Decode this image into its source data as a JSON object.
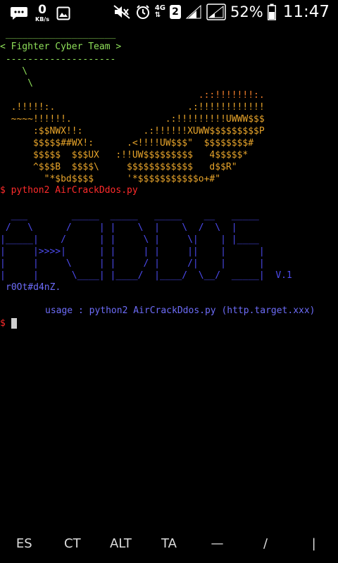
{
  "status_bar": {
    "speed_value": "0",
    "speed_unit": "KB/s",
    "network": "4G",
    "sim_slot": "2",
    "battery_percent": "52%",
    "time": "11:47"
  },
  "terminal": {
    "banner": {
      "top_rule": " ____________________",
      "team": "< Fighter Cyber Team >",
      "dashes": " --------------------",
      "slash1": "    \\",
      "slash2": "     \\"
    },
    "art": [
      {
        "text": "                                    .::!!!!!!!:.",
        "color": "orange2"
      },
      {
        "text": "  .!!!!!:.                        .:!!!!!!!!!!!!",
        "color": "green_red"
      },
      {
        "text": "  ~~~~!!!!!!.                 .:!!!!!!!!!UWWW$$$",
        "color": "mix"
      },
      {
        "text": "      :$$NWX!!:           .:!!!!!!XUWW$$$$$$$$$P",
        "color": "mix"
      },
      {
        "text": "      $$$$$##WX!:      .<!!!!UW$$$\"  $$$$$$$$#",
        "color": "mix"
      },
      {
        "text": "      $$$$$  $$$UX   :!!UW$$$$$$$$$   4$$$$$*",
        "color": "mix"
      },
      {
        "text": "      ^$$$B  $$$$\\     $$$$$$$$$$$$   d$$R\"",
        "color": "mix"
      },
      {
        "text": "        \"*$bd$$$$      '*$$$$$$$$$$$o+#\"",
        "color": "mix"
      }
    ],
    "command_prompt": "$",
    "command": "python2 AirCrackDdos.py",
    "logo_lines": [
      "  ___        _____  _____   _____    __   _____",
      " /   \\      /     | |    \\  |    \\  /  \\  |",
      "|_____|    /      | |     \\ |     \\|    | |____",
      "|     |>>>>|      | |     | |     ||    |      |",
      "|     |     \\     | |     / |     /|    |      |",
      "|     |      \\____| |____/  |____/  \\__/  _____|  V.1"
    ],
    "author": "r0Ot#d4nZ.",
    "usage": "usage : python2 AirCrackDdos.py (http.target.xxx)",
    "final_prompt": "$"
  },
  "keys": [
    {
      "label": "ES"
    },
    {
      "label": "CT"
    },
    {
      "label": "ALT"
    },
    {
      "label": "TA"
    },
    {
      "label": "—"
    },
    {
      "label": "/"
    },
    {
      "label": "|"
    }
  ],
  "colors": {
    "background": "#000000",
    "banner_green": "#8fe05a",
    "art_orange": "#e6a32a",
    "art_red": "#e8433a",
    "logo_blue": "#4d4bf0",
    "prompt_red": "#ff2b2b"
  }
}
